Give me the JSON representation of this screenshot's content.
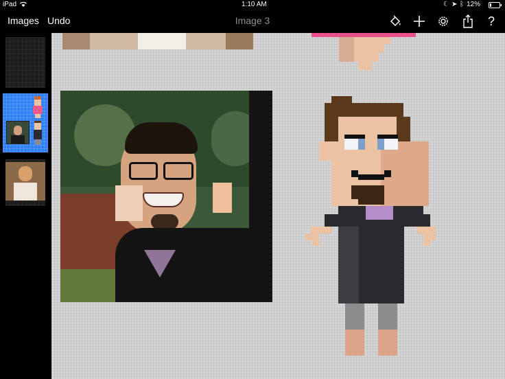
{
  "status": {
    "device": "iPad",
    "time": "1:10 AM",
    "battery": "12%"
  },
  "nav": {
    "images_label": "Images",
    "undo_label": "Undo",
    "title": "Image 3"
  },
  "toolbar": {
    "icons": [
      "paint-bucket-icon",
      "plus-icon",
      "gear-icon",
      "share-icon",
      "help-icon"
    ],
    "help_glyph": "?"
  },
  "sidebar": {
    "thumbnails": [
      {
        "label": "image-1",
        "selected": false
      },
      {
        "label": "image-3",
        "selected": true
      },
      {
        "label": "image-2",
        "selected": false
      }
    ]
  },
  "colors": {
    "accent": "#2f7ff5",
    "canvas": "#d5d5d5",
    "skin": "#ecc2a5",
    "hair": "#5a3a1a",
    "shirt": "#2a2a2e",
    "undershirt": "#b48cc8",
    "pants": "#8c8c8c"
  }
}
